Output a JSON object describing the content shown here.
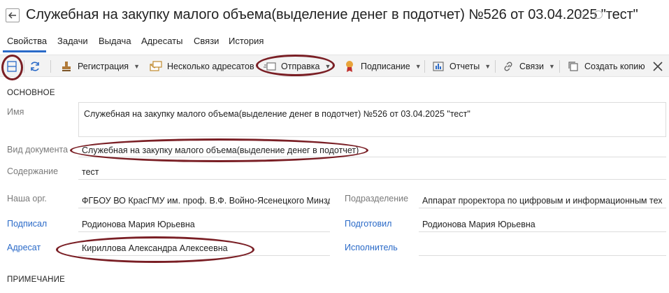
{
  "window": {
    "title": "Служебная на закупку малого объема(выделение денег в подотчет) №526 от 03.04.2025 \"тест\""
  },
  "tabs": [
    {
      "label": "Свойства",
      "active": true
    },
    {
      "label": "Задачи"
    },
    {
      "label": "Выдача"
    },
    {
      "label": "Адресаты"
    },
    {
      "label": "Связи"
    },
    {
      "label": "История"
    }
  ],
  "toolbar": {
    "registration": "Регистрация",
    "several_addressees": "Несколько адресатов",
    "sending": "Отправка",
    "signing": "Подписание",
    "reports": "Отчеты",
    "links": "Связи",
    "create_copy": "Создать копию"
  },
  "sections": {
    "main": "ОСНОВНОЕ",
    "note": "ПРИМЕЧАНИЕ"
  },
  "fields": {
    "name": {
      "label": "Имя",
      "value": "Служебная на закупку малого объема(выделение денег в подотчет) №526 от 03.04.2025 \"тест\""
    },
    "doc_type": {
      "label": "Вид документа",
      "value": "Служебная на закупку малого объема(выделение денег в подотчет)"
    },
    "content": {
      "label": "Содержание",
      "value": "тест"
    },
    "our_org": {
      "label": "Наша орг.",
      "value": "ФГБОУ ВО КрасГМУ им. проф. В.Ф. Войно-Ясенецкого Минзд"
    },
    "division": {
      "label": "Подразделение",
      "value": "Аппарат проректора по цифровым и информационным тех"
    },
    "signed_by": {
      "label": "Подписал",
      "value": "Родионова Мария Юрьевна"
    },
    "prepared_by": {
      "label": "Подготовил",
      "value": "Родионова Мария Юрьевна"
    },
    "addressee": {
      "label": "Адресат",
      "value": "Кириллова Александра Алексеевна"
    },
    "executor": {
      "label": "Исполнитель",
      "value": ""
    }
  },
  "colors": {
    "accent": "#2a6ac8",
    "annotation": "#7a1f25",
    "toolbar_bg": "#f3f3f3"
  }
}
